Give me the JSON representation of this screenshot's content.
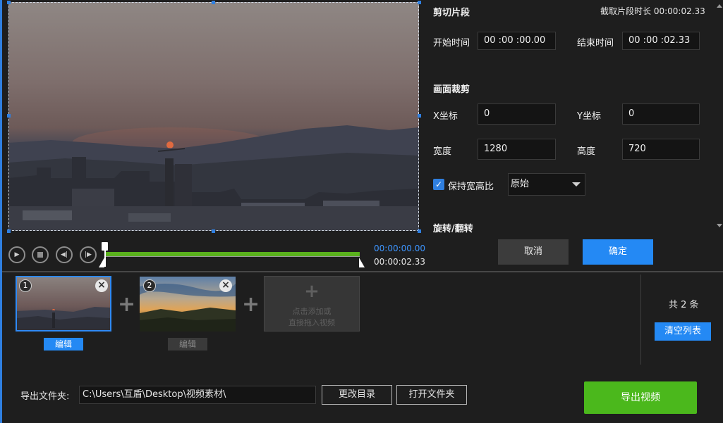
{
  "colors": {
    "accent_blue": "#2489f4",
    "export_green": "#4bb81c",
    "timeline_green": "#5ab11d",
    "time_blue": "#3d95ff",
    "background": "#1e1e1e"
  },
  "player": {
    "current_time": "00:00:00.00",
    "duration": "00:00:02.33",
    "controls": [
      "play-icon",
      "stop-icon",
      "prev-frame-icon",
      "next-frame-icon"
    ]
  },
  "trim": {
    "section_title": "剪切片段",
    "clip_length_label": "截取片段时长 00:00:02.33",
    "start_label": "开始时间",
    "start_value": "00 :00 :00.00",
    "end_label": "结束时间",
    "end_value": "00 :00 :02.33"
  },
  "crop": {
    "section_title": "画面裁剪",
    "x_label": "X坐标",
    "x_value": "0",
    "y_label": "Y坐标",
    "y_value": "0",
    "width_label": "宽度",
    "width_value": "1280",
    "height_label": "高度",
    "height_value": "720",
    "keep_ratio_label": "保持宽高比",
    "keep_ratio_checked": true,
    "ratio_selected": "原始"
  },
  "rotate": {
    "section_title": "旋转/翻转"
  },
  "actions": {
    "cancel_label": "取消",
    "confirm_label": "确定"
  },
  "clips": {
    "items": [
      {
        "number": "1",
        "edit_label": "编辑",
        "active": true
      },
      {
        "number": "2",
        "edit_label": "编辑",
        "active": false
      }
    ],
    "add_slot_line1": "点击添加或",
    "add_slot_line2": "直接拖入视频",
    "count_label": "共 2 条",
    "clear_label": "清空列表"
  },
  "export": {
    "folder_label": "导出文件夹:",
    "folder_path": "C:\\Users\\互盾\\Desktop\\视频素材\\",
    "change_dir_label": "更改目录",
    "open_folder_label": "打开文件夹",
    "export_label": "导出视频"
  }
}
